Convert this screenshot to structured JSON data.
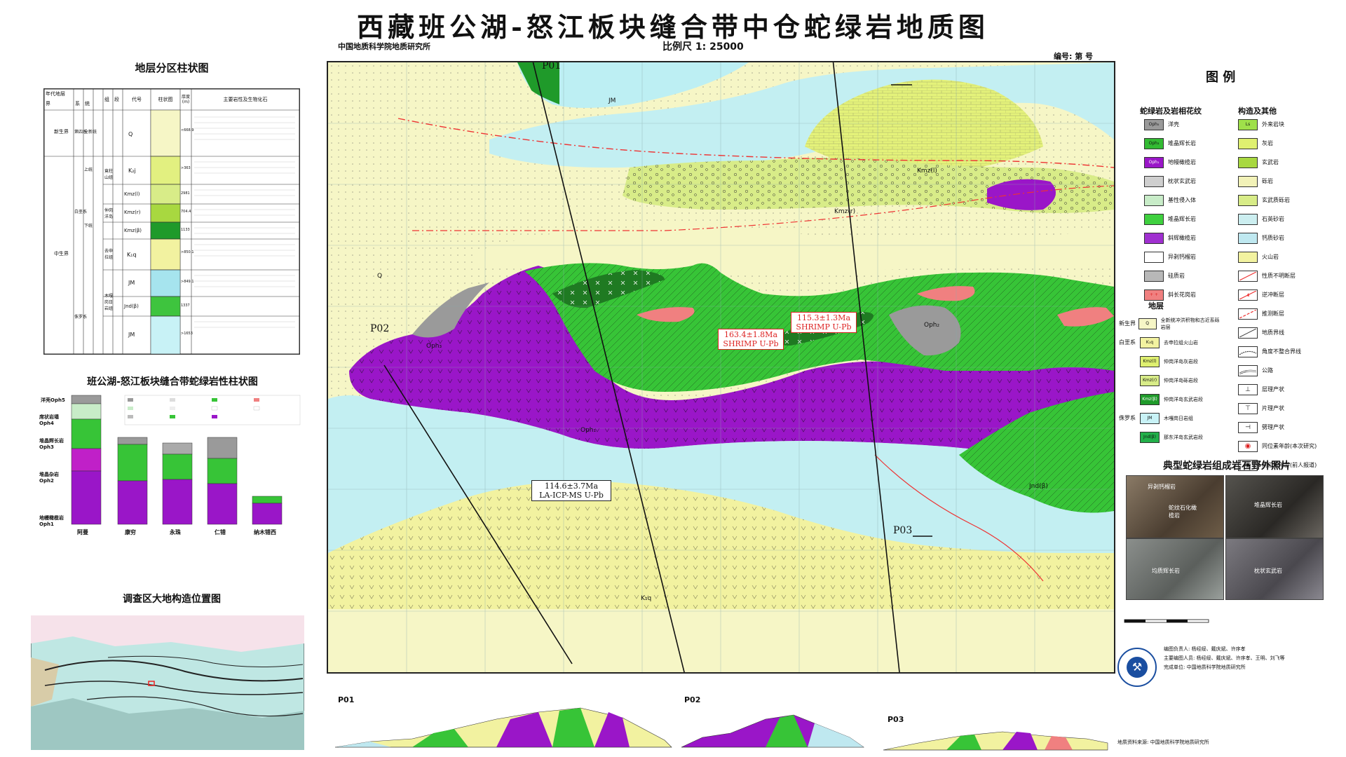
{
  "title": "西藏班公湖-怒江板块缝合带中仓蛇绿岩地质图",
  "institute": "中国地质科学院地质研究所",
  "scale": "比例尺 1: 25000",
  "serial": "编号: 第   号",
  "left_panel": {
    "strat_title": "地层分区柱状图",
    "strat_headers": [
      "年代地层",
      "组",
      "段",
      "层",
      "代号",
      "柱状图",
      "厚度(m)",
      "主要岩性及生物化石"
    ],
    "strat_subheaders": [
      "界",
      "系",
      "统"
    ],
    "strat_rows": [
      {
        "era": "新生界",
        "system": "第四系",
        "series": "全新统",
        "group": "",
        "code": "Q",
        "thick": "<668.9"
      },
      {
        "era": "中生界",
        "system": "白垩系",
        "series": "上统",
        "group": "竟柱山组",
        "code": "K₂j",
        "thick": ">363"
      },
      {
        "era": "",
        "system": "",
        "series": "下统",
        "group": "仲岗洋岛",
        "code": "Kmz(l)",
        "thick": "2981"
      },
      {
        "era": "",
        "system": "",
        "series": "",
        "group": "",
        "code": "Kmz(r)",
        "thick": "704.4"
      },
      {
        "era": "",
        "system": "",
        "series": "",
        "group": "",
        "code": "Kmz(β)",
        "thick": "1133"
      },
      {
        "era": "",
        "system": "",
        "series": "",
        "group": "去申拉组",
        "code": "K₁q",
        "thick": ">850.1"
      },
      {
        "era": "",
        "system": "侏罗系",
        "series": "",
        "group": "木嘎岗日岩组",
        "code": "JM",
        "thick": ">849.1"
      },
      {
        "era": "",
        "system": "",
        "series": "",
        "group": "",
        "code": "Jnd(β)",
        "thick": "1337"
      },
      {
        "era": "",
        "system": "",
        "series": "",
        "group": "",
        "code": "JM",
        "thick": ">1653"
      }
    ],
    "column_title": "班公湖-怒江板块缝合带蛇绿岩性柱状图",
    "column_units": [
      "洋壳Oph5",
      "席状岩墙Oph4",
      "堆晶辉长岩Oph3",
      "堆晶杂岩Oph2",
      "地幔橄榄岩Oph1"
    ],
    "column_sites": [
      "阿曼",
      "康穷",
      "永珠",
      "仁错",
      "纳木错西"
    ],
    "location_title": "调查区大地构造位置图"
  },
  "map": {
    "profiles": [
      "P01",
      "P02",
      "P03"
    ],
    "ages": [
      {
        "age": "115.3±1.3Ma",
        "method": "SHRIMP U-Pb"
      },
      {
        "age": "163.4±1.8Ma",
        "method": "SHRIMP U-Pb"
      },
      {
        "age": "114.6±3.7Ma",
        "method": "LA-ICP-MS U-Pb"
      }
    ],
    "unit_labels": [
      "Q",
      "JM",
      "Kmz(l)",
      "Kmz(r)",
      "K₁q",
      "Oph₃",
      "Oph₁",
      "Oph₂",
      "Jnd(β)"
    ]
  },
  "legend": {
    "title": "图 例",
    "col1_head": "蛇绿岩及岩相花纹",
    "col2_head": "构造及其他",
    "col1_items": [
      {
        "code": "Oph₅",
        "label": "洋壳",
        "color": "#9a9a9a"
      },
      {
        "code": "Oph₃",
        "label": "堆晶辉长岩",
        "color": "#33bb33"
      },
      {
        "code": "Oph₁",
        "label": "地幔橄榄岩",
        "color": "#9a16c8"
      },
      {
        "code": "",
        "label": "枕状玄武岩",
        "color": "#cfcfcf"
      },
      {
        "code": "",
        "label": "基性侵入体",
        "color": "#c8ecc8"
      },
      {
        "code": "",
        "label": "堆晶辉长岩",
        "color": "#3fd03f"
      },
      {
        "code": "",
        "label": "斜辉橄榄岩",
        "color": "#a030d0"
      },
      {
        "code": "",
        "label": "异剥钙榴岩",
        "color": "#ffffff"
      },
      {
        "code": "",
        "label": "硅质岩",
        "color": "#b8b8b8"
      },
      {
        "code": "",
        "label": "斜长花岗岩",
        "color": "#f08080"
      }
    ],
    "col2_items": [
      {
        "code": "Ls",
        "label": "外来岩块",
        "color": "#9fe04a"
      },
      {
        "code": "",
        "label": "灰岩",
        "color": "#dff070"
      },
      {
        "code": "",
        "label": "玄武岩",
        "color": "#a8d840"
      },
      {
        "code": "",
        "label": "砾岩",
        "color": "#f2f2b8"
      },
      {
        "code": "",
        "label": "玄武质砾岩",
        "color": "#d8ec88"
      },
      {
        "code": "",
        "label": "石英砂岩",
        "color": "#cceef0"
      },
      {
        "code": "",
        "label": "钙质砂岩",
        "color": "#bfe8f0"
      },
      {
        "code": "",
        "label": "火山岩",
        "color": "#f2f2a0"
      },
      {
        "code": "",
        "label": "性质不明断层",
        "color": "#ffffff"
      },
      {
        "code": "",
        "label": "逆冲断层",
        "color": "#ffffff"
      },
      {
        "code": "",
        "label": "推测断层",
        "color": "#ffffff"
      },
      {
        "code": "",
        "label": "地质界线",
        "color": "#ffffff"
      },
      {
        "code": "",
        "label": "角度不整合界线",
        "color": "#ffffff"
      },
      {
        "code": "",
        "label": "公路",
        "color": "#ffffff"
      },
      {
        "code": "",
        "label": "层理产状",
        "color": "#ffffff"
      },
      {
        "code": "",
        "label": "片理产状",
        "color": "#ffffff"
      },
      {
        "code": "",
        "label": "劈理产状",
        "color": "#ffffff"
      },
      {
        "code": "",
        "label": "同位素年龄(本次研究)",
        "color": "#ffffff"
      },
      {
        "code": "",
        "label": "同位素年龄(前人报道)",
        "color": "#ffffff"
      }
    ],
    "strata_head": "地层",
    "strata": [
      {
        "era": "新生界",
        "code": "Q",
        "label": "全新统冲洪积物和古近系砾岩层",
        "color": "#f6f6c6"
      },
      {
        "era": "白垩系",
        "code": "K₁q",
        "label": "去申拉组火山岩",
        "color": "#f2f2a0"
      },
      {
        "era": "",
        "code": "Kmz(l)",
        "label": "仲岗洋岛灰岩段",
        "color": "#dff070"
      },
      {
        "era": "",
        "code": "Kmz(r)",
        "label": "仲岗洋岛砾岩段",
        "color": "#d8ec88"
      },
      {
        "era": "",
        "code": "Kmz(β)",
        "label": "仲岗洋岛玄武岩段",
        "color": "#1f9a2a"
      },
      {
        "era": "侏罗系",
        "code": "JM",
        "label": "木嘎岗日岩组",
        "color": "#c8f2f6"
      },
      {
        "era": "",
        "code": "Jnd(β)",
        "label": "那东洋岛玄武岩段",
        "color": "#22b04a"
      }
    ]
  },
  "photos_title": "典型蛇绿岩组成岩石野外照片",
  "photo_labels": [
    "异剥钙榴岩",
    "堆晶辉长岩",
    "蛇纹石化橄榄岩",
    "均质辉长岩",
    "枕状玄武岩"
  ],
  "credits": [
    "编图负责人: 杨经绥、戴庆斌、许序孝",
    "主要编图人员: 杨经绥、戴庆斌、许序孝、王明、刘飞等",
    "完成单位: 中国地质科学院地质研究所"
  ],
  "bottom_credit": "地质资料来源: 中国地质科学院地质研究所",
  "profile_labels": [
    "P01",
    "P02",
    "P03"
  ]
}
